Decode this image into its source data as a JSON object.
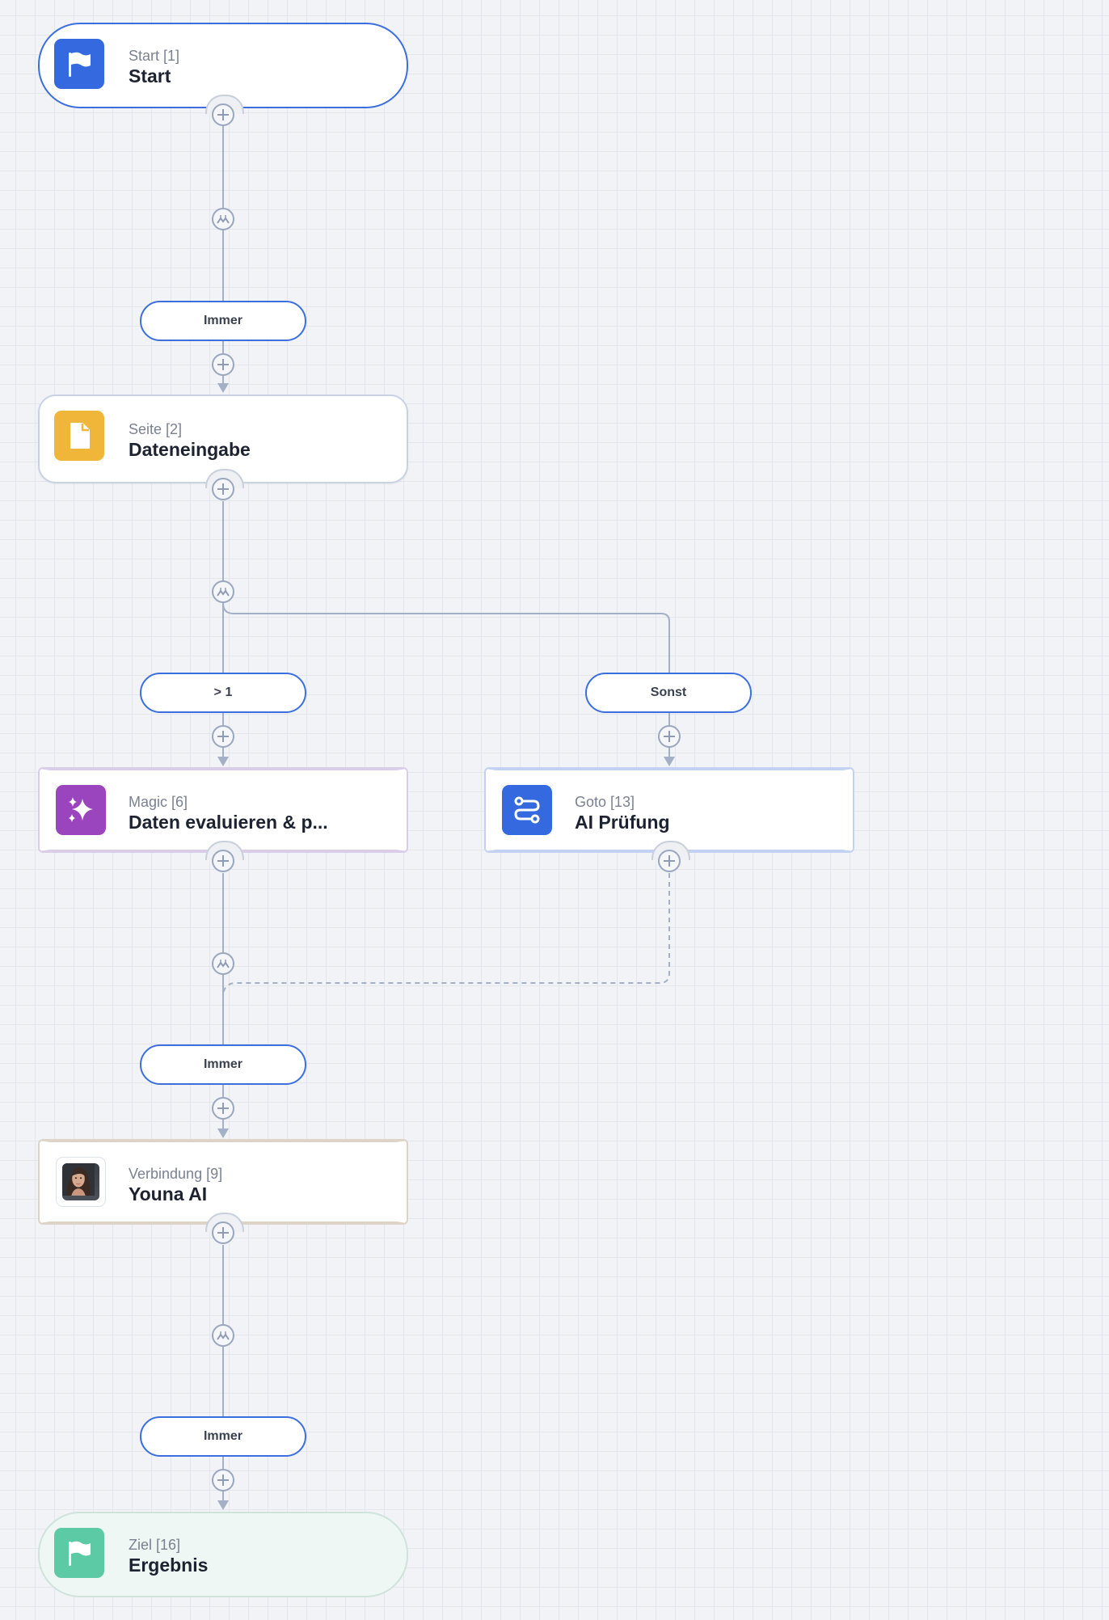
{
  "nodes": {
    "start": {
      "type_label": "Start [1]",
      "title": "Start",
      "icon": "flag-icon",
      "color": "#3469e0"
    },
    "page": {
      "type_label": "Seite [2]",
      "title": "Dateneingabe",
      "icon": "document-icon",
      "color": "#efb63a"
    },
    "magic": {
      "type_label": "Magic [6]",
      "title": "Daten evaluieren & p...",
      "icon": "sparkles-icon",
      "color": "#9a44bd"
    },
    "goto": {
      "type_label": "Goto [13]",
      "title": "AI Prüfung",
      "icon": "route-icon",
      "color": "#3469e0"
    },
    "connection": {
      "type_label": "Verbindung [9]",
      "title": "Youna AI",
      "icon": "avatar-icon"
    },
    "goal": {
      "type_label": "Ziel [16]",
      "title": "Ergebnis",
      "icon": "flag-icon",
      "color": "#5ccba5"
    }
  },
  "conditions": {
    "c1": "Immer",
    "c2": "> 1",
    "c3": "Sonst",
    "c4": "Immer",
    "c5": "Immer"
  },
  "colors": {
    "accent": "#3b6fe0",
    "connector": "#a4b0c6",
    "background": "#f1f3f6"
  }
}
